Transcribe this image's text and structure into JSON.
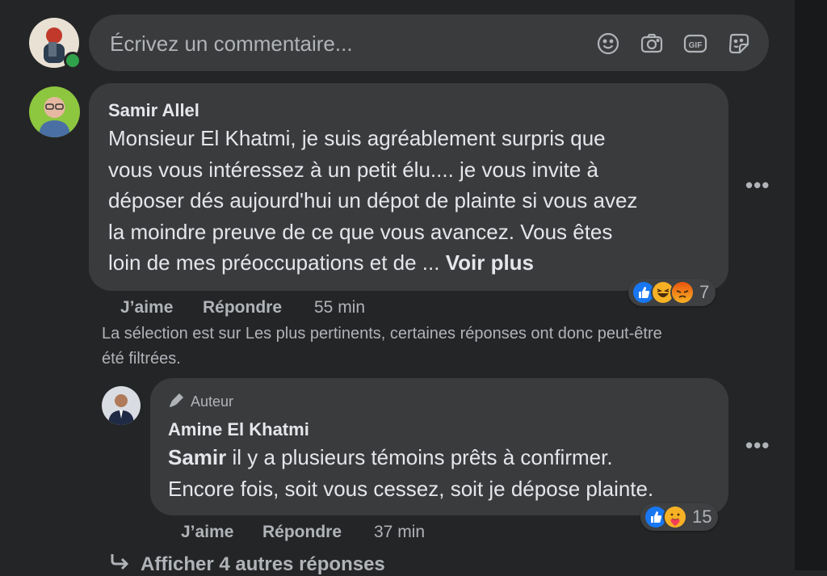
{
  "composer": {
    "placeholder": "Écrivez un commentaire...",
    "icons": [
      "emoji-icon",
      "camera-icon",
      "gif-icon",
      "sticker-icon"
    ]
  },
  "comments": [
    {
      "author": "Samir Allel",
      "lines": [
        "Monsieur El Khatmi, je suis agréablement surpris que",
        "vous vous intéressez à un petit élu.... je vous invite à",
        "déposer dés aujourd'hui un dépot de plainte si vous avez",
        "la moindre preuve de ce que vous avancez. Vous êtes",
        "loin de mes préoccupations et de ..."
      ],
      "see_more": "Voir plus",
      "reactions": [
        "like",
        "haha",
        "angry"
      ],
      "reaction_count": "7",
      "like_label": "J’aime",
      "reply_label": "Répondre",
      "time": "55 min"
    }
  ],
  "filter_notice": {
    "line1": "La sélection est sur Les plus pertinents, certaines réponses ont donc peut-être",
    "line2": "été filtrées."
  },
  "reply": {
    "badge": "Auteur",
    "author": "Amine El Khatmi",
    "mention": "Samir",
    "line1_rest": " il y a plusieurs témoins prêts à confirmer.",
    "line2": "Encore fois, soit vous cessez, soit je dépose plainte.",
    "reactions": [
      "like",
      "care"
    ],
    "reaction_count": "15",
    "like_label": "J’aime",
    "reply_label": "Répondre",
    "time": "37 min"
  },
  "more_replies": "Afficher 4 autres réponses",
  "colors": {
    "background": "#242526",
    "bubble": "#3a3b3c",
    "text": "#e4e6eb",
    "muted": "#b0b3b8",
    "like_blue": "#1877f2",
    "online_green": "#31a24c"
  }
}
